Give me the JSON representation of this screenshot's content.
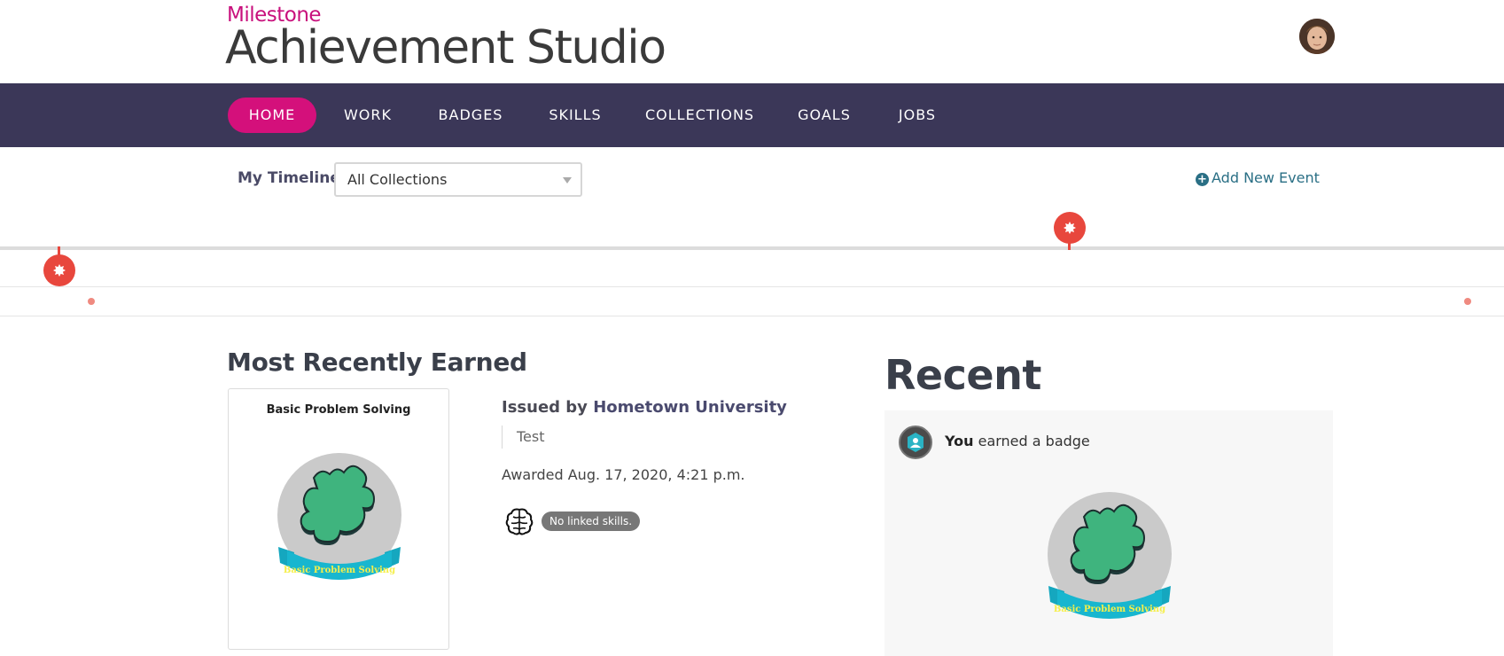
{
  "header": {
    "brand_top": "Milestone",
    "brand_main": "Achievement Studio"
  },
  "nav": {
    "items": [
      {
        "label": "HOME",
        "active": true
      },
      {
        "label": "WORK",
        "active": false
      },
      {
        "label": "BADGES",
        "active": false
      },
      {
        "label": "SKILLS",
        "active": false
      },
      {
        "label": "COLLECTIONS",
        "active": false
      },
      {
        "label": "GOALS",
        "active": false
      },
      {
        "label": "JOBS",
        "active": false
      }
    ]
  },
  "timeline": {
    "label": "My Timeline",
    "filter_value": "All Collections",
    "add_event_label": "Add New Event"
  },
  "most_recent": {
    "title": "Most Recently Earned",
    "badge_name": "Basic Problem Solving",
    "badge_ribbon_text": "Basic Problem Solving",
    "issued_prefix": "Issued by",
    "issuer": "Hometown University",
    "description": "Test",
    "awarded": "Awarded Aug. 17, 2020, 4:21 p.m.",
    "skills_status": "No linked skills."
  },
  "recent": {
    "title": "Recent",
    "actor": "You",
    "action": "earned a badge",
    "badge_ribbon_text": "Basic Problem Solving"
  },
  "colors": {
    "brand_pink": "#d4107b",
    "nav_bg": "#3b3758",
    "pin_red": "#e8473d",
    "link_teal": "#2a6f85"
  }
}
